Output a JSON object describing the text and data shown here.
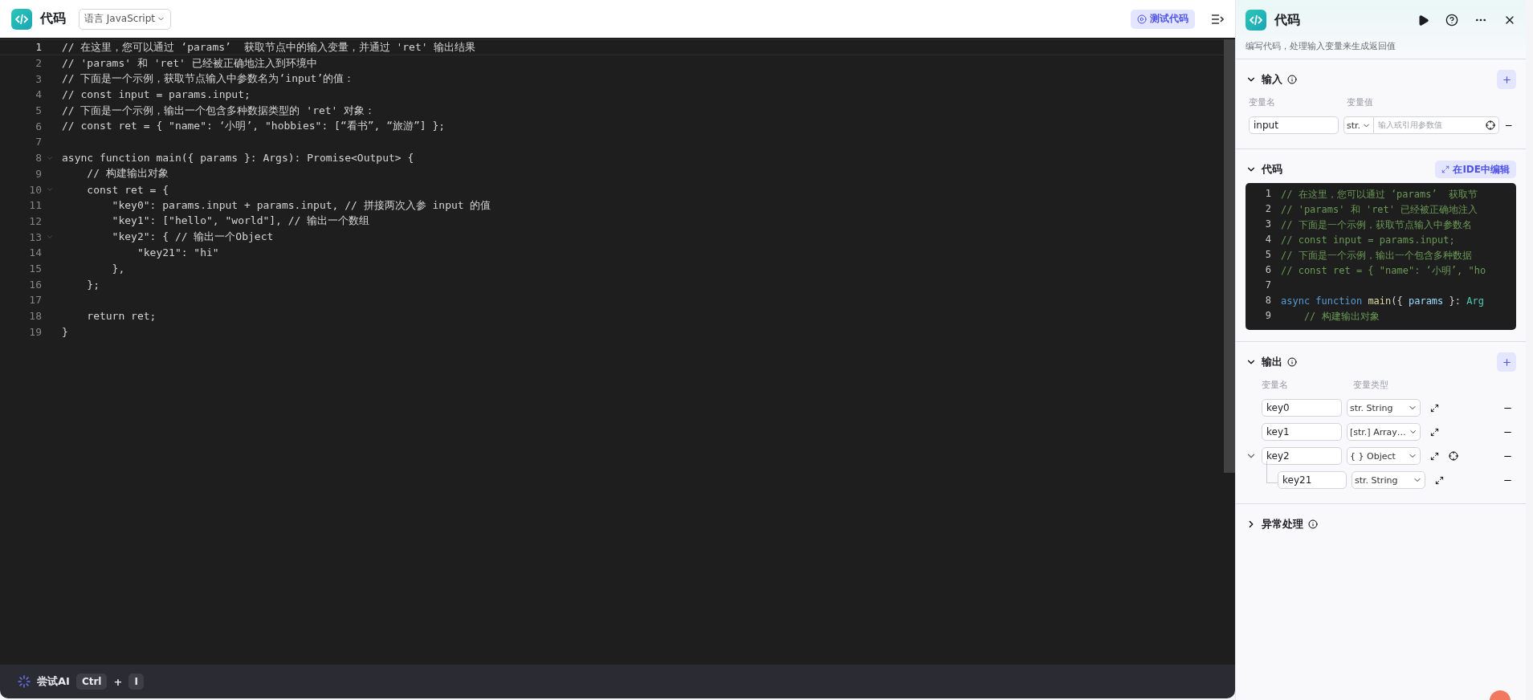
{
  "editor": {
    "title": "代码",
    "language": "语言 JavaScript",
    "test_button": "测试代码",
    "lines": [
      {
        "number": "1",
        "text": "// 在这里，您可以通过 ‘params’  获取节点中的输入变量，并通过 'ret' 输出结果",
        "foldable": false,
        "current": true
      },
      {
        "number": "2",
        "text": "// 'params' 和 'ret' 已经被正确地注入到环境中",
        "foldable": false,
        "current": false
      },
      {
        "number": "3",
        "text": "// 下面是一个示例，获取节点输入中参数名为‘input’的值：",
        "foldable": false,
        "current": false
      },
      {
        "number": "4",
        "text": "// const input = params.input;",
        "foldable": false,
        "current": false
      },
      {
        "number": "5",
        "text": "// 下面是一个示例，输出一个包含多种数据类型的 'ret' 对象：",
        "foldable": false,
        "current": false
      },
      {
        "number": "6",
        "text": "// const ret = { \"name\": ‘小明’, \"hobbies\": [“看书”, “旅游”] };",
        "foldable": false,
        "current": false
      },
      {
        "number": "7",
        "foldable": false,
        "current": false
      },
      {
        "number": "8",
        "text": "async function main({ params }: Args): Promise<Output> {",
        "foldable": true,
        "current": false
      },
      {
        "number": "9",
        "text": "    // 构建输出对象",
        "foldable": false,
        "current": false
      },
      {
        "number": "10",
        "text": "    const ret = {",
        "foldable": true,
        "current": false
      },
      {
        "number": "11",
        "text": "        \"key0\": params.input + params.input, // 拼接两次入参 input 的值",
        "foldable": false,
        "current": false
      },
      {
        "number": "12",
        "text": "        \"key1\": [\"hello\", \"world\"], // 输出一个数组",
        "foldable": false,
        "current": false
      },
      {
        "number": "13",
        "text": "        \"key2\": { // 输出一个Object",
        "foldable": true,
        "current": false
      },
      {
        "number": "14",
        "text": "            \"key21\": \"hi\"",
        "foldable": false,
        "current": false
      },
      {
        "number": "15",
        "text": "        },",
        "foldable": false,
        "current": false
      },
      {
        "number": "16",
        "text": "    };",
        "foldable": false,
        "current": false
      },
      {
        "number": "17",
        "foldable": false,
        "current": false
      },
      {
        "number": "18",
        "text": "    return ret;",
        "foldable": false,
        "current": false
      },
      {
        "number": "19",
        "text": "}",
        "foldable": false,
        "current": false
      }
    ],
    "ai_bar": {
      "label": "尝试AI",
      "keys": [
        "Ctrl",
        "I"
      ],
      "plus": "+"
    }
  },
  "panel": {
    "title": "代码",
    "description": "编写代码，处理输入变量来生成返回值",
    "input": {
      "title": "输入",
      "expanded": true,
      "columns": [
        "变量名",
        "变量值"
      ],
      "rows": [
        {
          "name": "input",
          "type": "str.",
          "placeholder": "输入或引用参数值"
        }
      ]
    },
    "code": {
      "title": "代码",
      "expanded": true,
      "ide_button": "在IDE中编辑",
      "lines": [
        {
          "number": "1",
          "tokens": [
            {
              "text": "// 在这里，您可以通过 ‘params’  获取节",
              "kind": "comment"
            }
          ]
        },
        {
          "number": "2",
          "tokens": [
            {
              "text": "// 'params' 和 'ret' 已经被正确地注入",
              "kind": "comment"
            }
          ]
        },
        {
          "number": "3",
          "tokens": [
            {
              "text": "// 下面是一个示例，获取节点输入中参数名",
              "kind": "comment"
            }
          ]
        },
        {
          "number": "4",
          "tokens": [
            {
              "text": "// const input = params.input;",
              "kind": "comment"
            }
          ]
        },
        {
          "number": "5",
          "tokens": [
            {
              "text": "// 下面是一个示例，输出一个包含多种数据",
              "kind": "comment"
            }
          ]
        },
        {
          "number": "6",
          "tokens": [
            {
              "text": "// const ret = { \"name\": ‘小明’, \"ho",
              "kind": "comment"
            }
          ]
        },
        {
          "number": "7"
        },
        {
          "number": "8",
          "tokens": [
            {
              "text": "async function",
              "kind": "keyword"
            },
            {
              "text": " main",
              "kind": "function"
            },
            {
              "text": "({",
              "kind": "plain"
            },
            {
              "text": " params",
              "kind": "variable"
            },
            {
              "text": " }:",
              "kind": "plain"
            },
            {
              "text": " Arg",
              "kind": "type"
            }
          ]
        },
        {
          "number": "9",
          "tokens": [
            {
              "text": "    // 构建输出对象",
              "kind": "comment"
            }
          ]
        }
      ]
    },
    "output": {
      "title": "输出",
      "expanded": true,
      "columns": [
        "变量名",
        "变量类型"
      ],
      "rows": [
        {
          "name": "key0",
          "type_icon": "str.",
          "type": "String"
        },
        {
          "name": "key1",
          "type_icon": "[str.]",
          "type": "Array…"
        },
        {
          "name": "key2",
          "type_icon": "{ }",
          "type": "Object",
          "expanded": true,
          "children": [
            {
              "name": "key21",
              "type_icon": "str.",
              "type": "String"
            }
          ]
        }
      ]
    },
    "error": {
      "title": "异常处理",
      "expanded": false
    }
  }
}
